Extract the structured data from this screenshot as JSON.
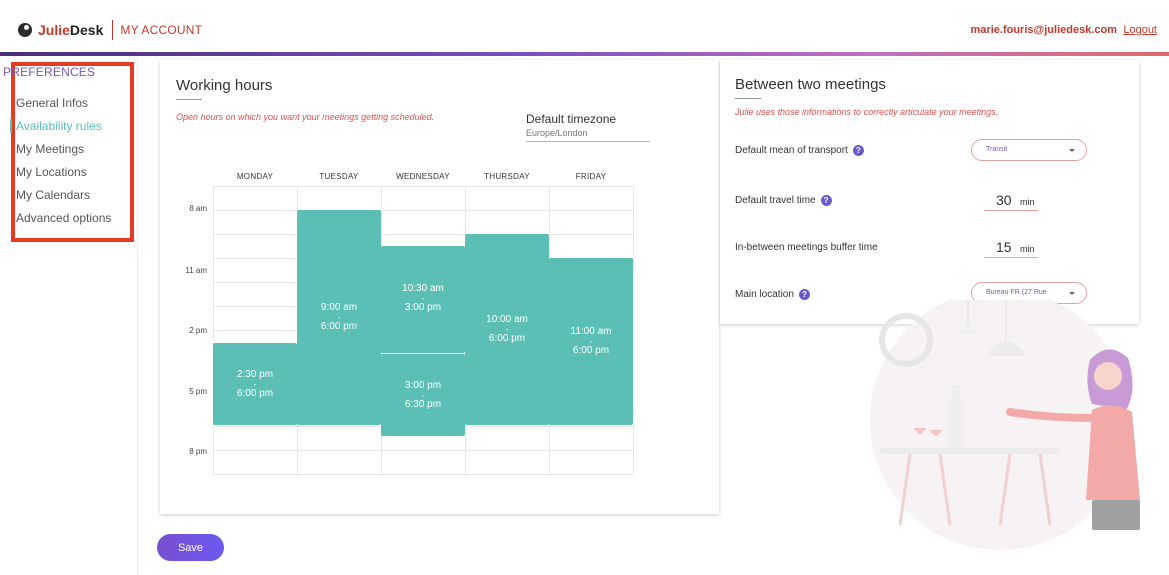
{
  "header": {
    "brand_julie": "Julie",
    "brand_desk": "Desk",
    "section": "MY ACCOUNT",
    "user_email": "marie.fouris@juliedesk.com",
    "logout_label": "Logout",
    "gradient_colors": [
      "#4a2e7a",
      "#7a4ec0",
      "#c070c0",
      "#e06a6a"
    ]
  },
  "sidebar": {
    "title": "PREFERENCES",
    "items": [
      {
        "label": "General Infos",
        "active": false
      },
      {
        "label": "Availability rules",
        "active": true
      },
      {
        "label": "My Meetings",
        "active": false
      },
      {
        "label": "My Locations",
        "active": false
      },
      {
        "label": "My Calendars",
        "active": false
      },
      {
        "label": "Advanced options",
        "active": false
      }
    ],
    "highlight_color": "#e53a23",
    "active_color": "#5bbfb5"
  },
  "working_hours": {
    "title": "Working hours",
    "subtitle": "Open hours on which you want your meetings getting scheduled.",
    "timezone_label": "Default timezone",
    "timezone_value": "Europe/London",
    "days": [
      "MONDAY",
      "TUESDAY",
      "WEDNESDAY",
      "THURSDAY",
      "FRIDAY"
    ],
    "time_labels": [
      "8 am",
      "11 am",
      "2 pm",
      "5 pm",
      "8 pm"
    ],
    "slot_color": "#5bbfb5",
    "slots": [
      {
        "day": "MONDAY",
        "start": "2:30 pm",
        "end": "6:00 pm",
        "sep": "-"
      },
      {
        "day": "TUESDAY",
        "start": "9:00 am",
        "end": "6:00 pm",
        "sep": "-"
      },
      {
        "day": "WEDNESDAY",
        "start": "10:30 am",
        "end": "3:00 pm",
        "sep": "-"
      },
      {
        "day": "WEDNESDAY",
        "start": "3:00 pm",
        "end": "6:30 pm",
        "sep": "-"
      },
      {
        "day": "THURSDAY",
        "start": "10:00 am",
        "end": "6:00 pm",
        "sep": "-"
      },
      {
        "day": "FRIDAY",
        "start": "11:00 am",
        "end": "6:00 pm",
        "sep": "-"
      }
    ]
  },
  "between_meetings": {
    "title": "Between two meetings",
    "subtitle": "Julie uses those informations to correctly articulate your meetings.",
    "transport_label": "Default mean of transport",
    "transport_value": "Transit",
    "travel_label": "Default travel time",
    "travel_value": "30",
    "travel_unit": "min",
    "buffer_label": "In-between meetings buffer time",
    "buffer_value": "15",
    "buffer_unit": "min",
    "location_label": "Main location",
    "location_value": "Bureau FR (27 Rue",
    "help_icon": "question-mark-icon"
  },
  "actions": {
    "save_label": "Save"
  }
}
